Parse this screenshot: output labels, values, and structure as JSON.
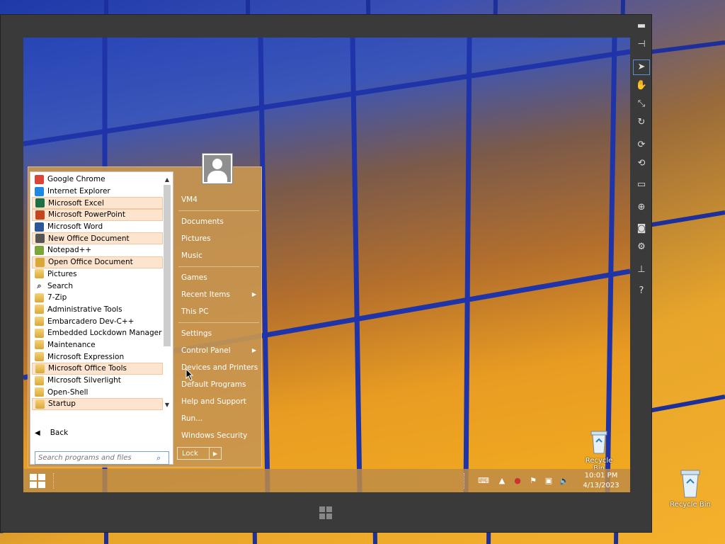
{
  "start_menu": {
    "programs": [
      {
        "label": "Google Chrome",
        "icon": "chrome-icon",
        "hl": false,
        "color": "#db4437"
      },
      {
        "label": "Internet Explorer",
        "icon": "ie-icon",
        "hl": false,
        "color": "#1e88e5"
      },
      {
        "label": "Microsoft Excel",
        "icon": "excel-icon",
        "hl": true,
        "color": "#1d7044"
      },
      {
        "label": "Microsoft PowerPoint",
        "icon": "powerpoint-icon",
        "hl": true,
        "color": "#c4461f"
      },
      {
        "label": "Microsoft Word",
        "icon": "word-icon",
        "hl": false,
        "color": "#2b579a"
      },
      {
        "label": "New Office Document",
        "icon": "new-office-document-icon",
        "hl": true,
        "color": "#555555"
      },
      {
        "label": "Notepad++",
        "icon": "notepadpp-icon",
        "hl": false,
        "color": "#7aa63a"
      },
      {
        "label": "Open Office Document",
        "icon": "open-office-document-icon",
        "hl": true,
        "color": "#d9a838"
      },
      {
        "label": "Pictures",
        "icon": "folder-icon",
        "hl": false,
        "color": "folder"
      },
      {
        "label": "Search",
        "icon": "search-icon",
        "hl": false,
        "color": "search"
      },
      {
        "label": "7-Zip",
        "icon": "folder-icon",
        "hl": false,
        "color": "folder"
      },
      {
        "label": "Administrative Tools",
        "icon": "folder-icon",
        "hl": false,
        "color": "folder"
      },
      {
        "label": "Embarcadero Dev-C++",
        "icon": "folder-icon",
        "hl": false,
        "color": "folder"
      },
      {
        "label": "Embedded Lockdown Manager",
        "icon": "folder-icon",
        "hl": false,
        "color": "folder"
      },
      {
        "label": "Maintenance",
        "icon": "folder-icon",
        "hl": false,
        "color": "folder"
      },
      {
        "label": "Microsoft Expression",
        "icon": "folder-icon",
        "hl": false,
        "color": "folder"
      },
      {
        "label": "Microsoft Office Tools",
        "icon": "folder-icon",
        "hl": true,
        "color": "folder"
      },
      {
        "label": "Microsoft Silverlight",
        "icon": "folder-icon",
        "hl": false,
        "color": "folder"
      },
      {
        "label": "Open-Shell",
        "icon": "folder-icon",
        "hl": false,
        "color": "folder"
      },
      {
        "label": "Startup",
        "icon": "folder-icon",
        "hl": true,
        "color": "folder"
      }
    ],
    "back_label": "Back",
    "search_placeholder": "Search programs and files",
    "user_name": "VM4",
    "places": [
      {
        "label": "Documents",
        "sub": false,
        "sep_after": false
      },
      {
        "label": "Pictures",
        "sub": false,
        "sep_after": false
      },
      {
        "label": "Music",
        "sub": false,
        "sep_after": true
      },
      {
        "label": "Games",
        "sub": false,
        "sep_after": false
      },
      {
        "label": "Recent Items",
        "sub": true,
        "sep_after": false
      },
      {
        "label": "This PC",
        "sub": false,
        "sep_after": true
      },
      {
        "label": "Settings",
        "sub": false,
        "sep_after": false
      },
      {
        "label": "Control Panel",
        "sub": true,
        "sep_after": false
      },
      {
        "label": "Devices and Printers",
        "sub": false,
        "sep_after": false
      },
      {
        "label": "Default Programs",
        "sub": false,
        "sep_after": false
      },
      {
        "label": "Help and Support",
        "sub": false,
        "sep_after": false
      },
      {
        "label": "Run...",
        "sub": false,
        "sep_after": false
      },
      {
        "label": "Windows Security",
        "sub": false,
        "sep_after": false
      }
    ],
    "lock_label": "Lock"
  },
  "taskbar": {
    "time": "10:01 PM",
    "date": "4/13/2023"
  },
  "vm_desktop": {
    "recycle_bin_label": "Recycle Bin"
  },
  "host_desktop": {
    "recycle_bin_label": "Recycle Bin"
  }
}
